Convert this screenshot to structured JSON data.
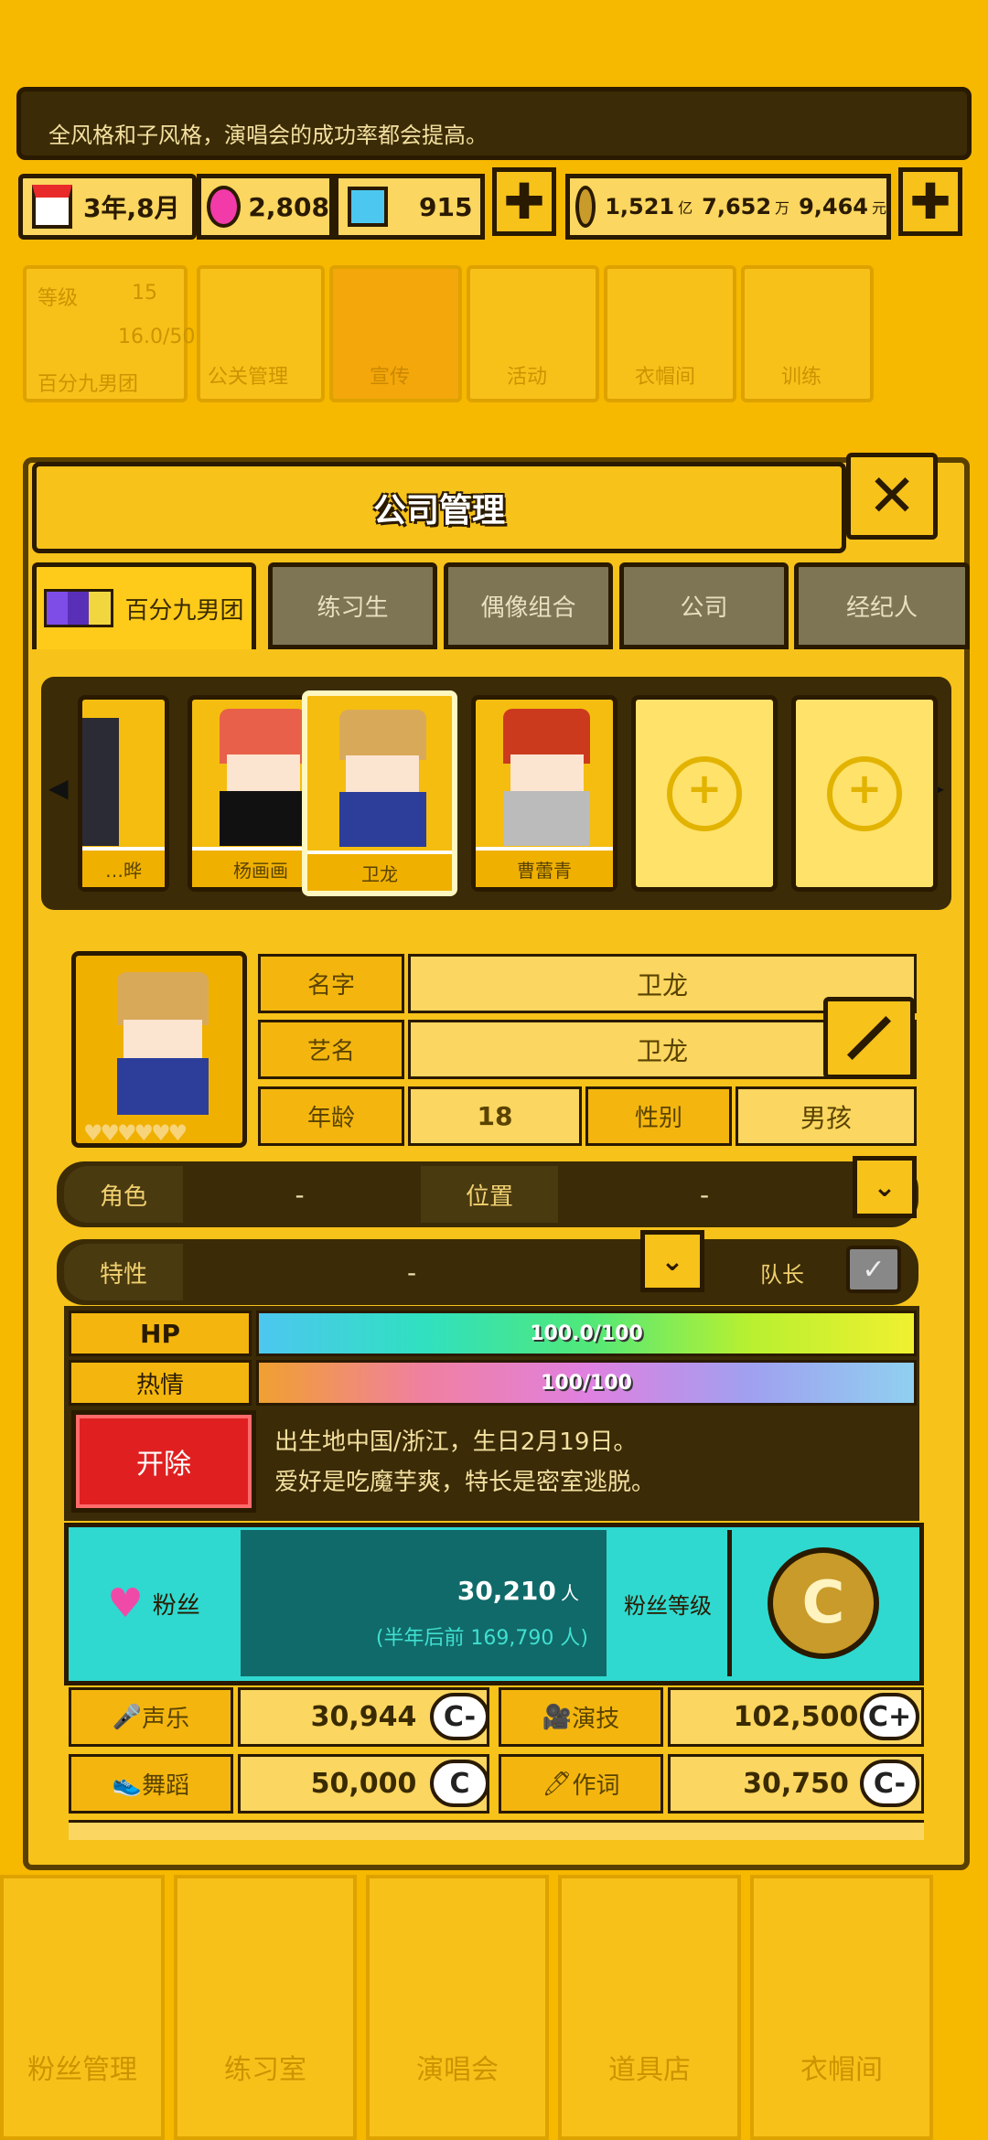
{
  "header": {
    "message": "全风格和子风格，演唱会的成功率都会提高。",
    "date_label": "3年,8月",
    "pink_gems": "2,808",
    "blue_gems": "915",
    "money": {
      "yi_value": "1,521",
      "yi_unit": "亿",
      "wan_value": "7,652",
      "wan_unit": "万",
      "yuan_value": "9,464",
      "yuan_unit": "元"
    }
  },
  "background_panel": {
    "level_label": "等级",
    "level_value": "15",
    "members_value": "16.0/50",
    "group_name": "百分九男团",
    "menu": [
      "公关管理",
      "宣传",
      "活动",
      "衣帽间",
      "训练"
    ]
  },
  "dialog": {
    "title": "公司管理",
    "close_icon": "close-icon",
    "tabs": [
      "百分九男团",
      "练习生",
      "偶像组合",
      "公司",
      "经纪人"
    ],
    "active_tab": 0,
    "roster": [
      {
        "name": "…晔",
        "hair": "#2b2b35"
      },
      {
        "name": "杨画画",
        "hair": "#e8604a"
      },
      {
        "name": "卫龙",
        "hair": "#d9a95a"
      },
      {
        "name": "曹蕾青",
        "hair": "#cc3a1e"
      }
    ],
    "empty_slots": 2
  },
  "profile": {
    "name_label": "名字",
    "name_value": "卫龙",
    "stage_label": "艺名",
    "stage_value": "卫龙",
    "age_label": "年龄",
    "age_value": "18",
    "gender_label": "性别",
    "gender_value": "男孩",
    "role_label": "角色",
    "role_value": "-",
    "position_label": "位置",
    "position_value": "-",
    "trait_label": "特性",
    "trait_value": "-",
    "leader_label": "队长",
    "hp_label": "HP",
    "hp_value": "100.0/100",
    "passion_label": "热情",
    "passion_value": "100/100",
    "fire_button": "开除",
    "bio_line1": "出生地中国/浙江，生日2月19日。",
    "bio_line2": "爱好是吃魔芋爽，特长是密室逃脱。",
    "fans_label": "粉丝",
    "fans_value": "30,210",
    "fans_unit": "人",
    "fans_sub": "(半年后前 169,790 人)",
    "fan_rank_label": "粉丝等级"
  },
  "stats": [
    {
      "name": "声乐",
      "value": "30,944",
      "grade": "C-",
      "icon": "microphone-icon"
    },
    {
      "name": "演技",
      "value": "102,500",
      "grade": "C+",
      "icon": "camera-icon"
    },
    {
      "name": "舞蹈",
      "value": "50,000",
      "grade": "C",
      "icon": "shoe-icon"
    },
    {
      "name": "作词",
      "value": "30,750",
      "grade": "C-",
      "icon": "pen-icon"
    }
  ],
  "bottom_nav": [
    "粉丝管理",
    "练习室",
    "演唱会",
    "道具店",
    "衣帽间"
  ],
  "colors": {
    "bg": "#F7B800",
    "dark": "#3b2b06",
    "cyan": "#2fd9d0",
    "red": "#e02020"
  }
}
